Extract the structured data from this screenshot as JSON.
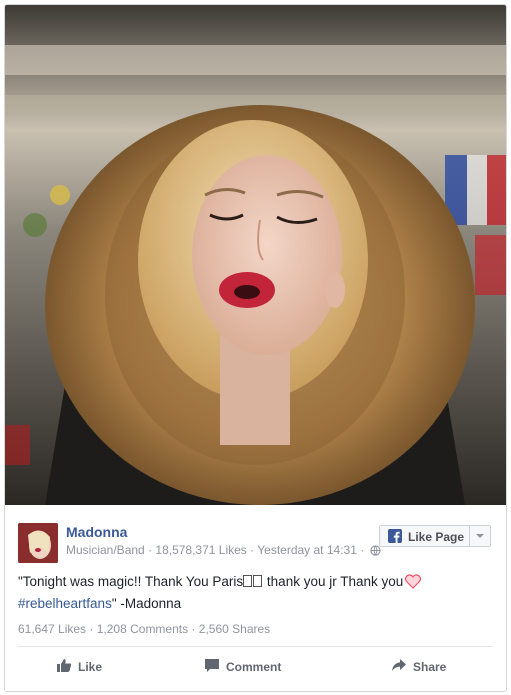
{
  "post": {
    "page_name": "Madonna",
    "category": "Musician/Band",
    "likes_count": "18,578,371 Likes",
    "timestamp": "Yesterday at 14:31",
    "like_page_label": "Like Page",
    "text_main": "\"Tonight was magic!! Thank You Paris",
    "text_after_boxes": " thank you jr Thank you",
    "hashtag": "#rebelheartfans",
    "text_signoff": "\" -Madonna"
  },
  "stats": {
    "likes": "61,647 Likes",
    "comments": "1,208 Comments",
    "shares": "2,560 Shares",
    "separator": " · "
  },
  "actions": {
    "like_label": "Like",
    "comment_label": "Comment",
    "share_label": "Share"
  },
  "colors": {
    "page_name": "#3b5998",
    "hashtag": "#365899",
    "meta": "#90949c",
    "heart": "#f25268"
  },
  "icons": [
    "globe-icon",
    "facebook-icon",
    "chevron-down-icon",
    "heart-icon",
    "thumbs-up-icon",
    "comment-icon",
    "share-arrow-icon"
  ]
}
